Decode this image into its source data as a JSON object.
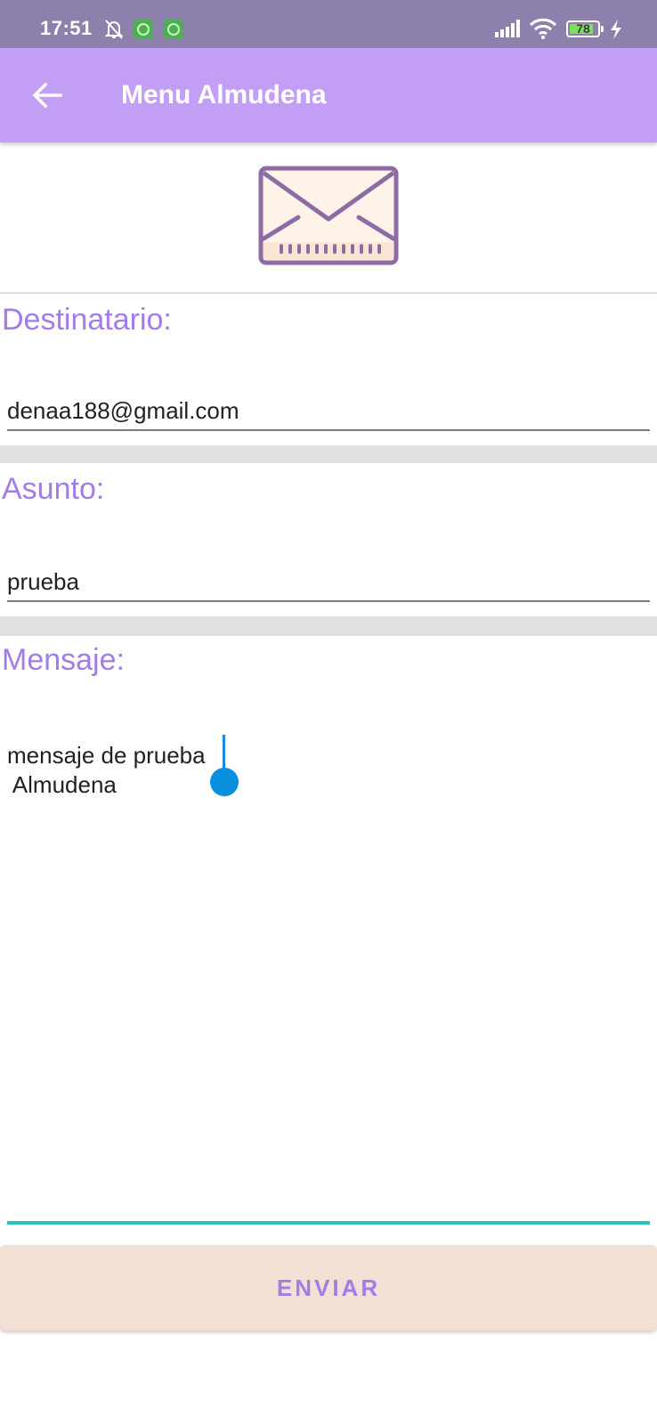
{
  "status_bar": {
    "time": "17:51",
    "battery_level": "78",
    "icons": [
      "bell-off-icon",
      "app-notification-icon",
      "app-notification-icon",
      "signal-icon",
      "wifi-icon",
      "battery-icon",
      "charging-icon"
    ]
  },
  "app_bar": {
    "title": "Menu Almudena",
    "back_icon": "arrow-left-icon",
    "background": "#c29ff5"
  },
  "header_icon": "envelope-icon",
  "form": {
    "recipient_label": "Destinatario:",
    "recipient_value": "denaa188@gmail.com",
    "subject_label": "Asunto:",
    "subject_value": "prueba",
    "message_label": "Mensaje:",
    "message_value": "mensaje de prueba\n Almudena"
  },
  "actions": {
    "send_label": "ENVIAR"
  },
  "colors": {
    "accent": "#a27ce8",
    "focus": "#26c6b5",
    "button_bg": "#f2e0d5"
  }
}
